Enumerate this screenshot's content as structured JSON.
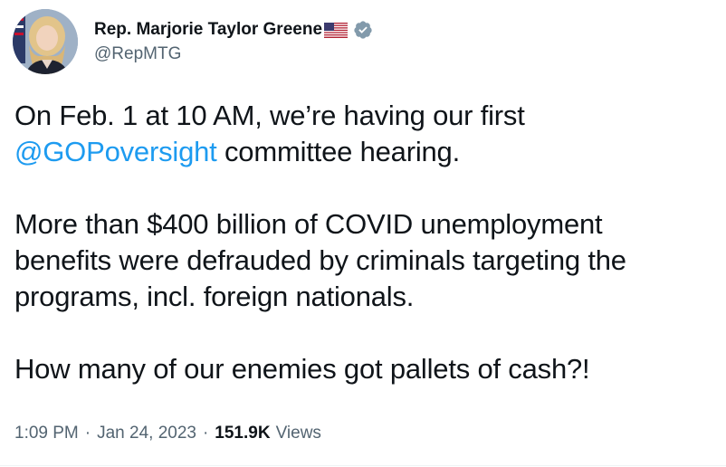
{
  "author": {
    "display_name": "Rep. Marjorie Taylor Greene",
    "handle": "@RepMTG",
    "flag_icon": "us-flag-icon",
    "verified_icon": "verified-badge-icon",
    "verified_color": "#829aab"
  },
  "tweet": {
    "line1": "On Feb. 1 at 10 AM, we’re having our first",
    "mention": "@GOPoversight",
    "line2_rest": " committee hearing.",
    "para2_line1": "More than $400 billion of COVID unemployment",
    "para2_line2": "benefits were defrauded by criminals targeting the",
    "para2_line3": "programs, incl. foreign nationals.",
    "para3": "How many of our enemies got pallets of cash?!"
  },
  "meta": {
    "time": "1:09 PM",
    "separator": "·",
    "date": "Jan 24, 2023",
    "views_count": "151.9K",
    "views_label": "Views"
  },
  "colors": {
    "text": "#0f1419",
    "secondary": "#536471",
    "link": "#1d9bf0"
  }
}
